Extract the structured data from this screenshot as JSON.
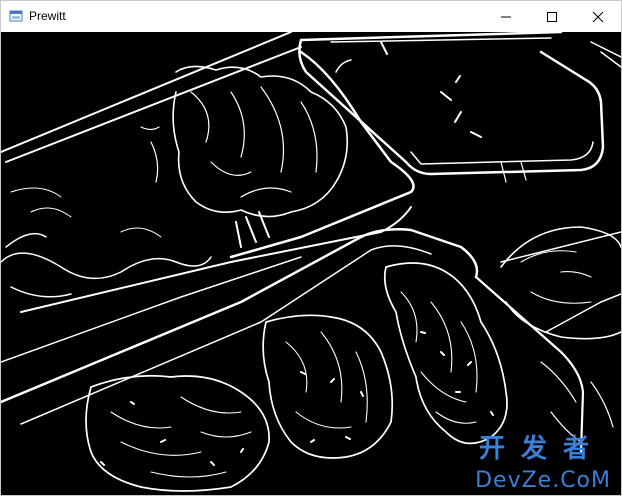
{
  "window": {
    "title": "Prewitt",
    "icon": "app-window-icon",
    "controls": {
      "minimize": "minimize-icon",
      "maximize": "maximize-icon",
      "close": "close-icon"
    }
  },
  "image": {
    "description_name": "edge-detection-output",
    "background": "#000000",
    "edge_color": "#ffffff"
  },
  "watermark": {
    "cn": "开发者",
    "en": "DevZe.CoM",
    "color": "#3b7fd6"
  }
}
